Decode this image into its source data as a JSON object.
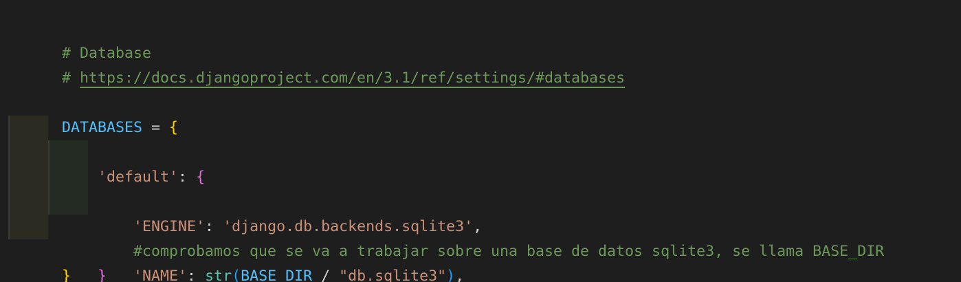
{
  "editor": {
    "lines": {
      "l1": {
        "comment": "# Database"
      },
      "l2": {
        "hash": "# ",
        "url": "https://docs.djangoproject.com/en/3.1/ref/settings/#databases"
      },
      "l4": {
        "ident": "DATABASES",
        "op": " = ",
        "brace": "{"
      },
      "l5": {
        "key": "'default'",
        "colon": ": ",
        "brace": "{"
      },
      "l6": {
        "key": "'ENGINE'",
        "colon": ": ",
        "value": "'django.db.backends.sqlite3'",
        "comma": ","
      },
      "l7": {
        "comment": "#comprobamos que se va a trabajar sobre una base de datos sqlite3, se llama BASE_DIR"
      },
      "l8": {
        "key": "'NAME'",
        "colon": ": ",
        "func": "str",
        "open_paren": "(",
        "arg": "BASE_DIR",
        "div": " / ",
        "value": "\"db.sqlite3\"",
        "close_paren": ")",
        "comma": ","
      },
      "l9": {
        "brace": "}"
      },
      "l10": {
        "brace": "}"
      }
    },
    "colors": {
      "background": "#1e1e1e",
      "comment": "#6a9955",
      "string": "#ce9178",
      "identifier": "#4fc1ff",
      "brace_level1": "#ffd700",
      "brace_level2": "#da70d6",
      "paren": "#179fff",
      "function": "#4ec9b0"
    }
  }
}
